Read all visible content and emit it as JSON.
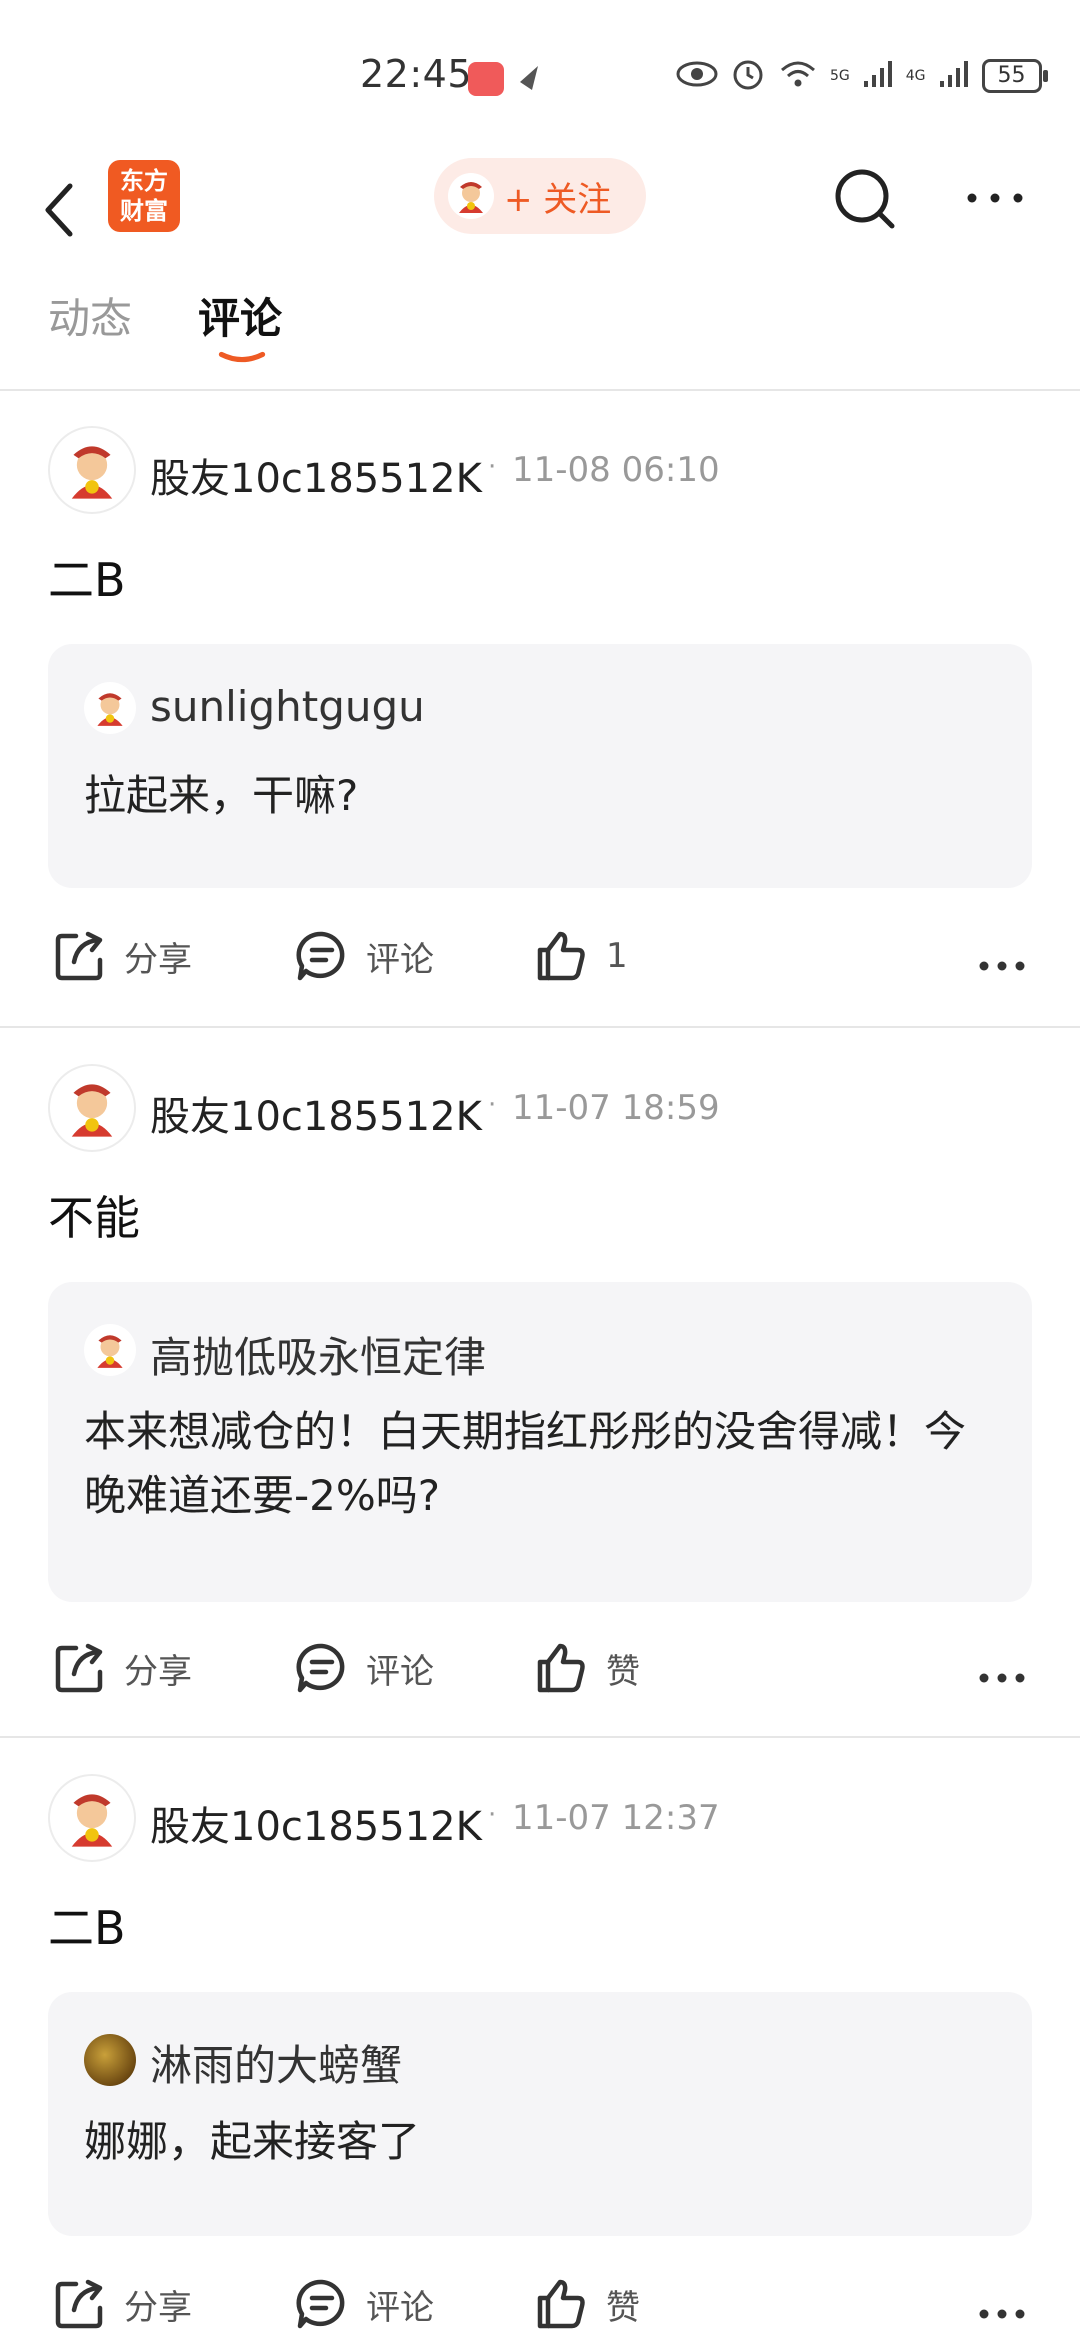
{
  "status_bar": {
    "time": "22:45",
    "battery": "55",
    "network_1": "5G",
    "network_2": "4G"
  },
  "nav": {
    "logo_text_line1": "东方",
    "logo_text_line2": "财富",
    "follow_label": "+ 关注"
  },
  "tabs": [
    {
      "label": "动态",
      "active": false
    },
    {
      "label": "评论",
      "active": true
    }
  ],
  "comments": [
    {
      "author": "股友10c185512K",
      "time": "11-08 06:10",
      "content": "二B",
      "quote": {
        "author": "sunlightgugu",
        "text": "拉起来，干嘛?",
        "avatar": "god-of-wealth-icon"
      },
      "actions": {
        "share": "分享",
        "comment": "评论",
        "like": "1"
      }
    },
    {
      "author": "股友10c185512K",
      "time": "11-07 18:59",
      "content": "不能",
      "quote": {
        "author": "高抛低吸永恒定律",
        "text": "本来想减仓的！白天期指红彤彤的没舍得减！今晚难道还要-2%吗?",
        "avatar": "god-of-wealth-icon"
      },
      "actions": {
        "share": "分享",
        "comment": "评论",
        "like": "赞"
      }
    },
    {
      "author": "股友10c185512K",
      "time": "11-07 12:37",
      "content": "二B",
      "quote": {
        "author": "淋雨的大螃蟹",
        "text": "娜娜，起来接客了",
        "avatar": "crab-photo-icon"
      },
      "actions": {
        "share": "分享",
        "comment": "评论",
        "like": "赞"
      }
    }
  ],
  "colors": {
    "accent": "#ee5a24",
    "quote_bg": "#f5f5f7",
    "divider": "#e6e6e6",
    "muted": "#999999"
  }
}
